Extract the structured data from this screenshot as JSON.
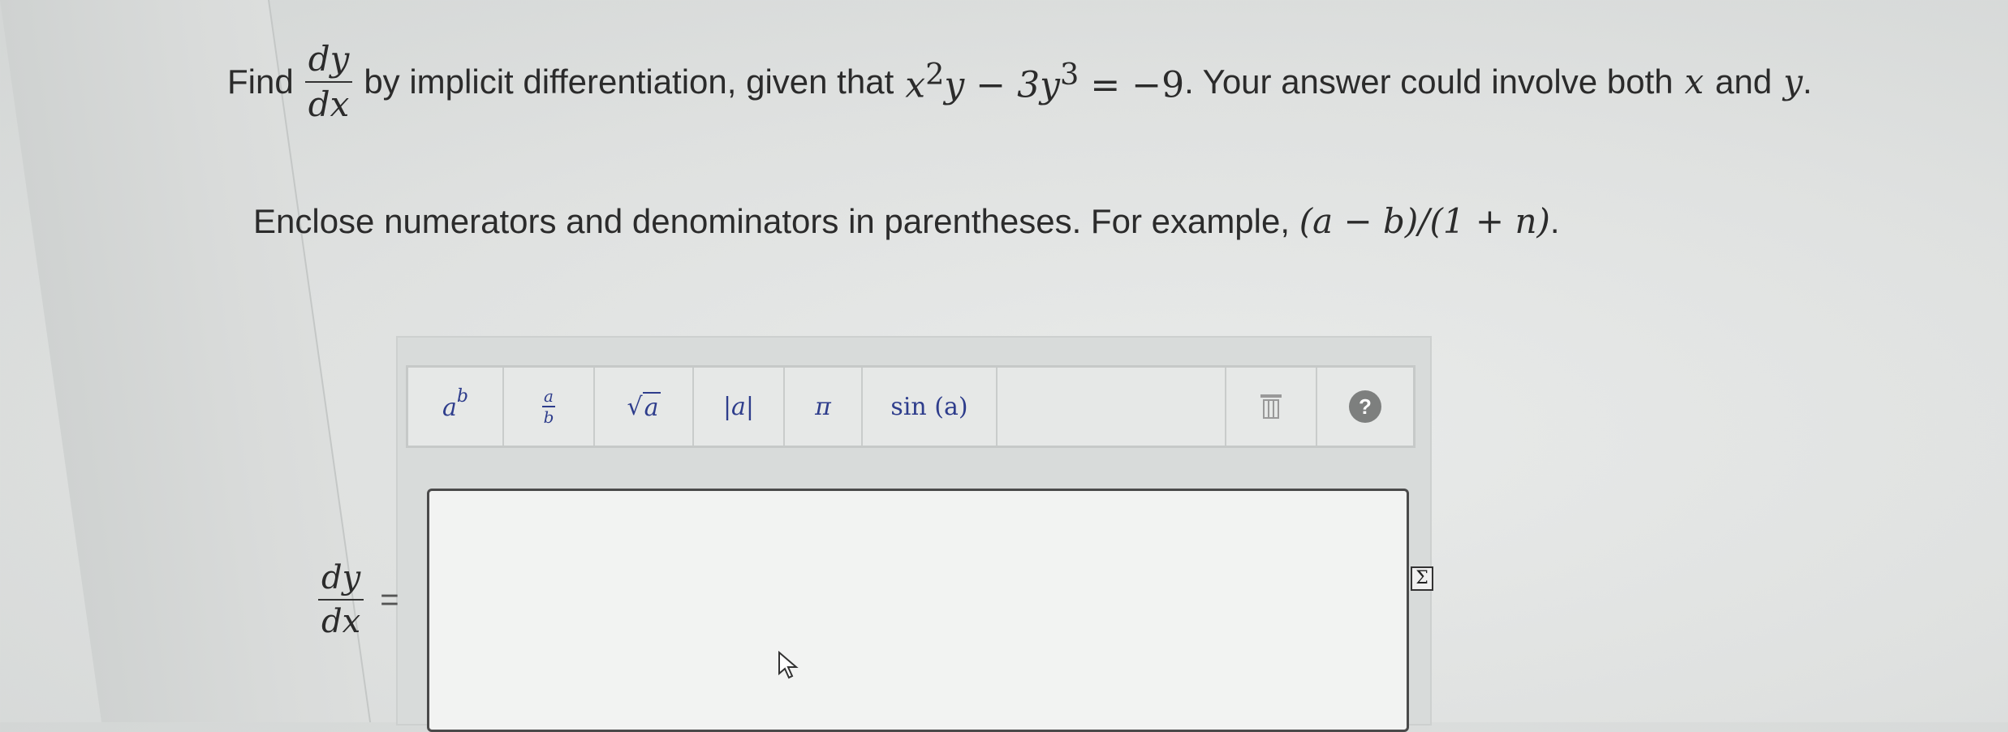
{
  "question": {
    "find": "Find",
    "dy": "dy",
    "dx": "dx",
    "mid": "by implicit differentiation, given that",
    "eq_x": "x",
    "eq_exp2": "2",
    "eq_y": "y",
    "eq_minus": "−",
    "eq_3y": "3y",
    "eq_exp3": "3",
    "eq_equals": "=",
    "eq_rhs": "−9",
    "tail1": ". Your answer could involve both",
    "var_x": "x",
    "and": "and",
    "var_y": "y",
    "period": "."
  },
  "instruction": {
    "text": "Enclose numerators and denominators in parentheses. For example,",
    "example": "(a − b)/(1 + n)",
    "period": "."
  },
  "toolbar": {
    "power_base": "a",
    "power_exp": "b",
    "frac_num": "a",
    "frac_den": "b",
    "sqrt_sym": "√",
    "sqrt_arg": "a",
    "abs": "|a|",
    "pi": "π",
    "sin": "sin (a)",
    "help": "?"
  },
  "answer": {
    "dy": "dy",
    "dx": "dx",
    "equals": "=",
    "value": ""
  },
  "icons": {
    "toolbar_sigma": "Σ"
  }
}
